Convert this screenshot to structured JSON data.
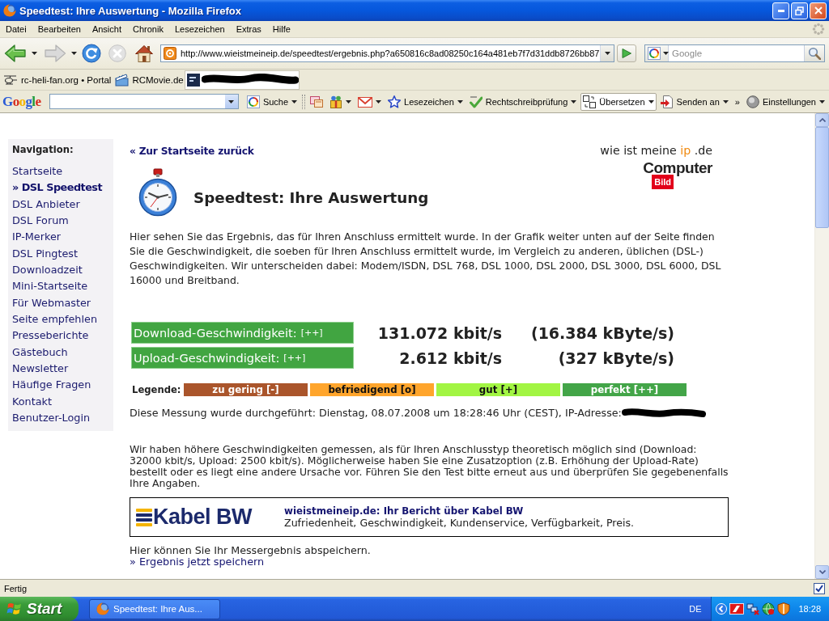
{
  "window": {
    "title": "Speedtest: Ihre Auswertung - Mozilla Firefox"
  },
  "menu_bar": {
    "items": [
      "Datei",
      "Bearbeiten",
      "Ansicht",
      "Chronik",
      "Lesezeichen",
      "Extras",
      "Hilfe"
    ]
  },
  "navigation_toolbar": {
    "buttons": [
      {
        "kind": "back",
        "disabled": false
      },
      {
        "kind": "forward",
        "disabled": true
      },
      {
        "kind": "reload",
        "disabled": false
      },
      {
        "kind": "stop",
        "disabled": true
      },
      {
        "kind": "home",
        "disabled": false
      }
    ],
    "address": {
      "value": "http://www.wieistmeineip.de/speedtest/ergebnis.php?a650816c8ad08250c164a481eb7f7d31ddb8726bb87"
    },
    "search": {
      "placeholder": "Google"
    }
  },
  "bookmarks_toolbar": {
    "items": [
      {
        "kind": "helicopter",
        "label": "rc-heli-fan.org • Portal"
      },
      {
        "kind": "clapperboard",
        "label": "RCMovie.de"
      },
      {
        "kind": "redacted"
      }
    ]
  },
  "google_toolbar": {
    "logo": "Google",
    "items": [
      {
        "kind": "search",
        "label": "Suche",
        "dropdown": true,
        "pressed": false
      },
      {
        "kind": "popup",
        "dropdown": false,
        "pressed": false
      },
      {
        "kind": "gift",
        "dropdown": true,
        "pressed": false
      },
      {
        "kind": "mail",
        "dropdown": true,
        "pressed": false
      },
      {
        "kind": "star",
        "label": "Lesezeichen",
        "dropdown": true,
        "pressed": false
      },
      {
        "kind": "spellcheck",
        "label": "Rechtschreibprüfung",
        "dropdown": true,
        "pressed": false
      },
      {
        "kind": "translate",
        "label": "Übersetzen",
        "dropdown": true,
        "pressed": true
      },
      {
        "kind": "send",
        "label": "Senden an",
        "dropdown": true,
        "pressed": false
      },
      {
        "kind": "overflow",
        "label": "»",
        "dropdown": false,
        "pressed": false
      },
      {
        "kind": "settings",
        "label": "Einstellungen",
        "dropdown": true,
        "pressed": false
      }
    ]
  },
  "page": {
    "sidebar": {
      "title": "Navigation:",
      "items": [
        {
          "label": "Startseite",
          "selected": false
        },
        {
          "label": "» DSL Speedtest",
          "selected": true
        },
        {
          "label": "DSL Anbieter",
          "selected": false
        },
        {
          "label": "DSL Forum",
          "selected": false
        },
        {
          "label": "IP-Merker",
          "selected": false
        },
        {
          "label": "DSL Pingtest",
          "selected": false
        },
        {
          "label": "Downloadzeit",
          "selected": false
        },
        {
          "label": "Mini-Startseite",
          "selected": false
        },
        {
          "label": "Für Webmaster",
          "selected": false
        },
        {
          "label": "Seite empfehlen",
          "selected": false
        },
        {
          "label": "Presseberichte",
          "selected": false
        },
        {
          "label": "Gästebuch",
          "selected": false
        },
        {
          "label": "Newsletter",
          "selected": false
        },
        {
          "label": "Häufige Fragen",
          "selected": false
        },
        {
          "label": "Kontakt",
          "selected": false
        },
        {
          "label": "Benutzer-Login",
          "selected": false
        }
      ]
    },
    "back_link": "« Zur Startseite zurück",
    "site_logo": {
      "text": "wie ist meine",
      "highlight": "ip",
      "suffix": ".de"
    },
    "partner_logo": {
      "name": "Computer",
      "badge": "Bild"
    },
    "heading": "Speedtest: Ihre Auswertung",
    "intro": "Hier sehen Sie das Ergebnis, das für Ihren Anschluss ermittelt wurde. In der Grafik weiter unten auf der Seite finden Sie die Geschwindigkeit, die soeben für Ihren Anschluss ermittelt wurde, im Vergleich zu anderen, üblichen (DSL-) Geschwindigkeiten. Wir unterscheiden dabei: Modem/ISDN, DSL 768, DSL 1000, DSL 2000, DSL 3000, DSL 6000, DSL 16000 und Breitband.",
    "results": [
      {
        "label": "Download-Geschwindigkeit:",
        "rating": "[++]",
        "color": "#41a541",
        "kbit": "131.072 kbit/s",
        "kbyte": "(16.384 kByte/s)"
      },
      {
        "label": "Upload-Geschwindigkeit:",
        "rating": "[++]",
        "color": "#41a541",
        "kbit": "2.612 kbit/s",
        "kbyte": "(327 kByte/s)"
      }
    ],
    "legend": {
      "title": "Legende:",
      "items": [
        {
          "label": "zu gering [-]",
          "color": "#aa552b"
        },
        {
          "label": "befriedigend [o]",
          "color": "#ffa52c"
        },
        {
          "label": "gut [+]",
          "color": "#a2f543"
        },
        {
          "label": "perfekt [++]",
          "color": "#43a548"
        }
      ]
    },
    "measurement": "Diese Messung wurde durchgeführt: Dienstag, 08.07.2008 um 18:28:46 Uhr (CEST), IP-Adresse:",
    "notice": "Wir haben höhere Geschwindigkeiten gemessen, als für Ihren Anschlusstyp theoretisch möglich sind (Download: 32000 kbit/s, Upload: 2500 kbit/s). Möglicherweise haben Sie eine Zusatzoption (z.B. Erhöhung der Upload-Rate) bestellt oder es liegt eine andere Ursache vor. Führen Sie den Test bitte erneut aus und überprüfen Sie gegebenenfalls Ihre Angaben.",
    "ad": {
      "logo": "Kabel BW",
      "title": "wieistmeineip.de: Ihr Bericht über Kabel BW",
      "text": "Zufriedenheit, Geschwindigkeit, Kundenservice, Verfügbarkeit, Preis."
    },
    "save_text": "Hier können Sie Ihr Messergebnis abspeichern.",
    "save_link": "» Ergebnis jetzt speichern"
  },
  "status_bar": {
    "text": "Fertig"
  },
  "taskbar": {
    "start": "Start",
    "tasks": [
      {
        "label": "Speedtest: Ihre Aus...",
        "selected": false
      }
    ],
    "language": "DE",
    "clock": "18:28"
  }
}
